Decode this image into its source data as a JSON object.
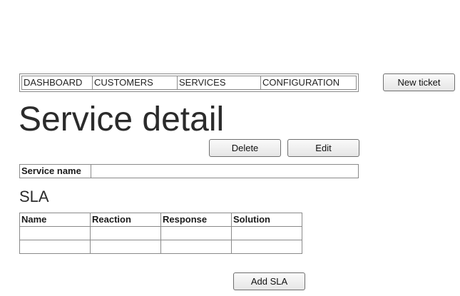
{
  "nav": {
    "items": [
      {
        "label": "DASHBOARD"
      },
      {
        "label": "CUSTOMERS"
      },
      {
        "label": "SERVICES"
      },
      {
        "label": "CONFIGURATION"
      }
    ]
  },
  "header": {
    "new_ticket_label": "New ticket"
  },
  "page": {
    "title": "Service detail"
  },
  "actions": {
    "delete_label": "Delete",
    "edit_label": "Edit"
  },
  "service": {
    "name_label": "Service name",
    "name_value": ""
  },
  "sla": {
    "heading": "SLA",
    "columns": [
      "Name",
      "Reaction",
      "Response",
      "Solution"
    ],
    "rows": [
      [
        "",
        "",
        "",
        ""
      ],
      [
        "",
        "",
        "",
        ""
      ]
    ],
    "add_label": "Add SLA"
  }
}
